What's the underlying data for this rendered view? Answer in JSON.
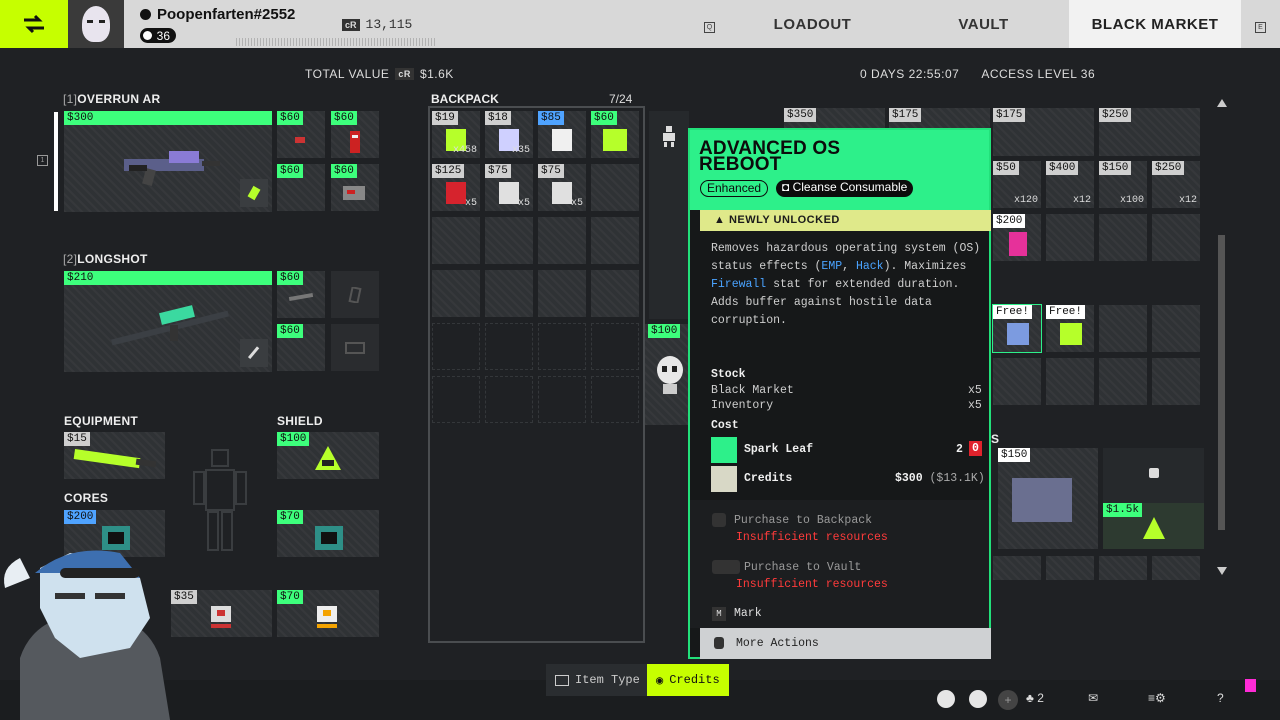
{
  "header": {
    "player_name": "Poopenfarten#2552",
    "player_level": "36",
    "credits_badge": "cR",
    "credits": "13,115",
    "key_left": "Q",
    "key_right": "E",
    "tabs": [
      {
        "label": "LOADOUT",
        "active": false
      },
      {
        "label": "VAULT",
        "active": false
      },
      {
        "label": "BLACK MARKET",
        "active": true
      }
    ]
  },
  "subheader": {
    "total_value_label": "TOTAL VALUE",
    "total_value_badge": "cR",
    "total_value": "$1.6K",
    "timer": "0 DAYS 22:55:07",
    "access_level": "ACCESS LEVEL 36"
  },
  "loadout": {
    "weapon1": {
      "index": "[1]",
      "name": "OVERRUN AR",
      "price": "$300",
      "mods": [
        "$60",
        "$60",
        "$60",
        "$60"
      ]
    },
    "weapon2": {
      "index": "[2]",
      "name": "LONGSHOT",
      "price": "$210",
      "mods": [
        "$60",
        "$60"
      ]
    },
    "equipment_label": "EQUIPMENT",
    "equipment_price": "$15",
    "shield_label": "SHIELD",
    "shield_price": "$100",
    "cores_label": "CORES",
    "cores_price_1": "$200",
    "cores_price_2": "$70",
    "bottom_prices": [
      "$35",
      "$70"
    ],
    "slot_hint": "1"
  },
  "backpack": {
    "title": "BACKPACK",
    "count": "7/24",
    "items": [
      {
        "price": "$19",
        "qty": "x458",
        "color": "grey"
      },
      {
        "price": "$18",
        "qty": "x35",
        "color": "grey"
      },
      {
        "price": "$85",
        "qty": "",
        "color": "blue"
      },
      {
        "price": "$60",
        "qty": "",
        "color": "green"
      },
      {
        "price": "$125",
        "qty": "x5",
        "color": "grey"
      },
      {
        "price": "$75",
        "qty": "x5",
        "color": "grey"
      },
      {
        "price": "$75",
        "qty": "x5",
        "color": "grey"
      }
    ],
    "side_price": "$100"
  },
  "tooltip": {
    "title_line1": "ADVANCED OS",
    "title_line2": "REBOOT",
    "tag_enhanced": "Enhanced",
    "tag_type": "Cleanse Consumable",
    "newly_unlocked": "NEWLY UNLOCKED",
    "desc_1": "Removes hazardous operating system (OS) status effects (",
    "desc_emp": "EMP",
    "desc_2": ", ",
    "desc_hack": "Hack",
    "desc_3": "). Maximizes ",
    "desc_firewall": "Firewall",
    "desc_4": " stat for extended duration.",
    "desc_5": "Adds buffer against hostile data corruption.",
    "stock_label": "Stock",
    "stock_market_label": "Black Market",
    "stock_market_value": "x5",
    "stock_inventory_label": "Inventory",
    "stock_inventory_value": "x5",
    "cost_label": "Cost",
    "cost_item_name": "Spark Leaf",
    "cost_item_need": "2",
    "cost_item_have": "0",
    "cost_credits_label": "Credits",
    "cost_credits_value": "$300",
    "cost_credits_have": "($13.1K)",
    "action_backpack": "Purchase to Backpack",
    "action_backpack_error": "Insufficient resources",
    "action_vault": "Purchase to Vault",
    "action_vault_error": "Insufficient resources",
    "mark_key": "M",
    "mark_label": "Mark",
    "more_actions": "More Actions"
  },
  "market": {
    "top_prices": [
      "$350",
      "$175",
      "$175",
      "$250"
    ],
    "row2": [
      {
        "price": "$50",
        "qty": "x120"
      },
      {
        "price": "$400",
        "qty": "x12"
      },
      {
        "price": "$150",
        "qty": "x100"
      },
      {
        "price": "$250",
        "qty": "x12"
      }
    ],
    "single_price": "$200",
    "free_label": "Free!",
    "section_fragment": "S",
    "weapon_price": "$150",
    "shield_price": "$1.5k"
  },
  "filters": {
    "item_type": "Item Type",
    "credits": "Credits"
  },
  "bottom": {
    "squad_count": "2",
    "help": "?"
  }
}
